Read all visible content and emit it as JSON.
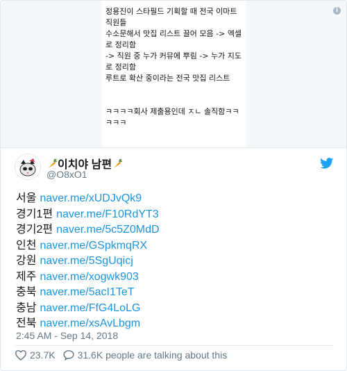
{
  "media": {
    "image_text": "정용진이 스타필드 기획할 때 전국 이마트 직원들\n수소문해서 맛집 리스트 끌어 모음 -> 엑셀로 정리함\n-> 직원 중 누가 커뮤에 뿌림 -> 누가 지도로 정리함\n루트로 확산 중이라는 전국 맛집 리스트\n\n\nㅋㅋㅋㅋ회사 제출용인데 ㅈㄴ 솔직함ㅋㅋㅋㅋㅋ",
    "info_icon": "info-icon"
  },
  "tweet": {
    "display_name": "이치야 남편",
    "name_emoji": "carrot",
    "handle": "@O8xO1",
    "lines": [
      {
        "region": "서울",
        "link": "naver.me/xUDJvQk9"
      },
      {
        "region": "경기1편",
        "link": "naver.me/F10RdYT3"
      },
      {
        "region": "경기2편",
        "link": "naver.me/5c5Z0MdD"
      },
      {
        "region": "인천",
        "link": "naver.me/GSpkmqRX"
      },
      {
        "region": "강원",
        "link": "naver.me/5SgUqicj"
      },
      {
        "region": "제주",
        "link": "naver.me/xogwk903"
      },
      {
        "region": "충북",
        "link": "naver.me/5acI1TeT"
      },
      {
        "region": "충남",
        "link": "naver.me/FfG4LoLG"
      },
      {
        "region": "전북",
        "link": "naver.me/xsAvLbgm"
      }
    ],
    "timestamp": "2:45 AM - Sep 14, 2018",
    "likes": "23.7K",
    "replies_text": "31.6K people are talking about this"
  },
  "colors": {
    "link": "#1b95e0",
    "secondary_text": "#657786",
    "twitter_blue": "#1da1f2"
  }
}
